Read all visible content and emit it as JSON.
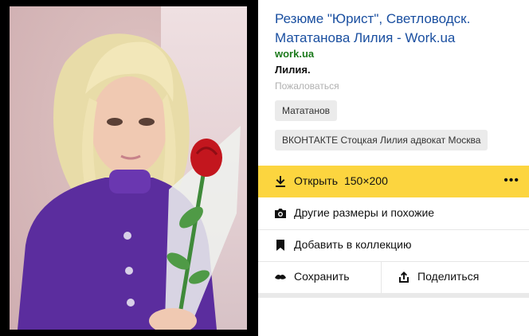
{
  "result": {
    "title": "Резюме \"Юрист\", Светловодск. Мататанова Лилия - Work.ua",
    "domain": "work.ua",
    "snippet": "Лилия.",
    "report": "Пожаловаться",
    "tags": [
      "Мататанов",
      "ВКОНТАКТЕ Стоцкая Лилия адвокат Москва"
    ]
  },
  "actions": {
    "open_label": "Открыть",
    "open_size": "150×200",
    "more_label": "•••",
    "similar_label": "Другие размеры и похожие",
    "collection_label": "Добавить в коллекцию",
    "save_label": "Сохранить",
    "share_label": "Поделиться"
  },
  "colors": {
    "accent": "#fcd53f",
    "link": "#1a4fa0",
    "domain": "#1c7a1c"
  }
}
